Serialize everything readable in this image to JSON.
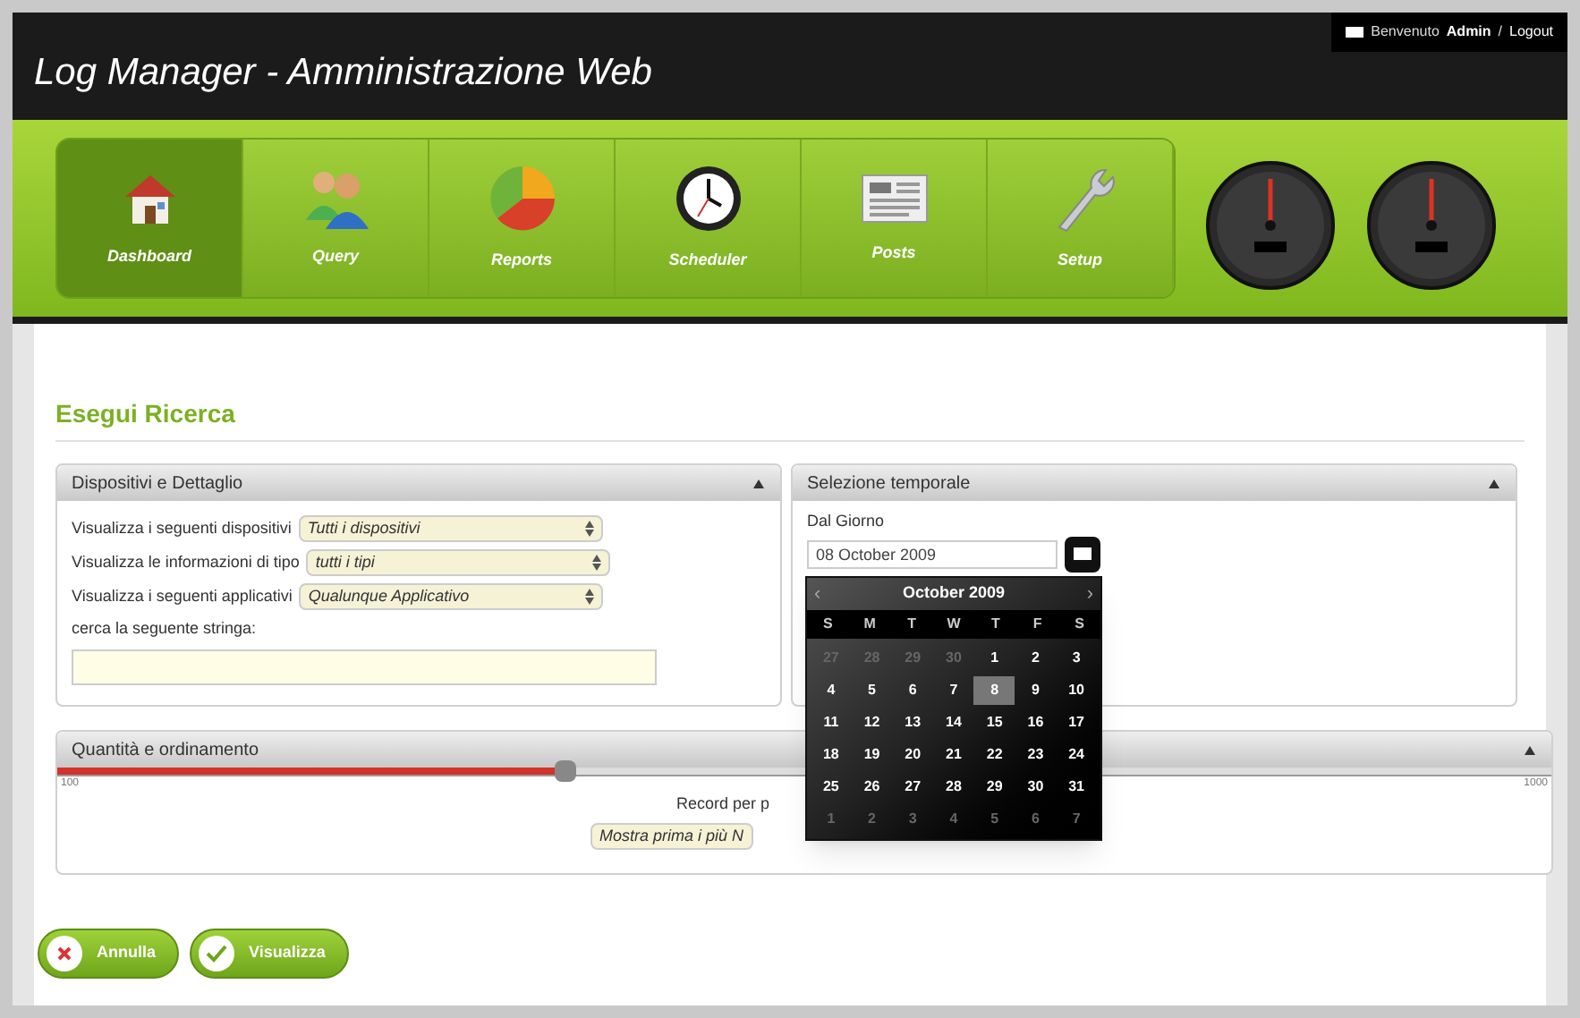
{
  "header": {
    "title": "Log Manager - Amministrazione Web",
    "welcome": "Benvenuto",
    "user": "Admin",
    "separator": "/",
    "logout": "Logout"
  },
  "nav": [
    {
      "label": "Dashboard",
      "selected": true
    },
    {
      "label": "Query",
      "selected": false
    },
    {
      "label": "Reports",
      "selected": false
    },
    {
      "label": "Scheduler",
      "selected": false
    },
    {
      "label": "Posts",
      "selected": false
    },
    {
      "label": "Setup",
      "selected": false
    }
  ],
  "page_title": "Esegui Ricerca",
  "devices_panel": {
    "title": "Dispositivi e Dettaglio",
    "expanded": true,
    "fields": [
      {
        "label": "Visualizza i seguenti dispositivi",
        "value": "Tutti i dispositivi"
      },
      {
        "label": "Visualizza le informazioni di tipo",
        "value": "tutti i tipi"
      },
      {
        "label": "Visualizza i seguenti applicativi",
        "value": "Qualunque Applicativo"
      }
    ],
    "search_label": "cerca la seguente stringa:"
  },
  "time_panel": {
    "title": "Selezione temporale",
    "expanded": true,
    "date_label": "Dal Giorno",
    "date_value": "08 October 2009"
  },
  "quantity_panel": {
    "title": "Quantità e ordinamento",
    "expanded": true,
    "slider": {
      "level": 0.34,
      "min_label": "100",
      "max_label": "1000"
    },
    "records_label": "Record per p",
    "order_value": "Mostra prima i più N"
  },
  "calendar": {
    "month": "October 2009",
    "prev": "‹",
    "next": "›",
    "weekdays": [
      "S",
      "M",
      "T",
      "W",
      "T",
      "F",
      "S"
    ],
    "days": [
      {
        "text": "27",
        "muted": true,
        "selected": false
      },
      {
        "text": "28",
        "muted": true,
        "selected": false
      },
      {
        "text": "29",
        "muted": true,
        "selected": false
      },
      {
        "text": "30",
        "muted": true,
        "selected": false
      },
      {
        "text": "1",
        "muted": false,
        "selected": false
      },
      {
        "text": "2",
        "muted": false,
        "selected": false
      },
      {
        "text": "3",
        "muted": false,
        "selected": false
      },
      {
        "text": "4",
        "muted": false,
        "selected": false
      },
      {
        "text": "5",
        "muted": false,
        "selected": false
      },
      {
        "text": "6",
        "muted": false,
        "selected": false
      },
      {
        "text": "7",
        "muted": false,
        "selected": false
      },
      {
        "text": "8",
        "muted": false,
        "selected": true
      },
      {
        "text": "9",
        "muted": false,
        "selected": false
      },
      {
        "text": "10",
        "muted": false,
        "selected": false
      },
      {
        "text": "11",
        "muted": false,
        "selected": false
      },
      {
        "text": "12",
        "muted": false,
        "selected": false
      },
      {
        "text": "13",
        "muted": false,
        "selected": false
      },
      {
        "text": "14",
        "muted": false,
        "selected": false
      },
      {
        "text": "15",
        "muted": false,
        "selected": false
      },
      {
        "text": "16",
        "muted": false,
        "selected": false
      },
      {
        "text": "17",
        "muted": false,
        "selected": false
      },
      {
        "text": "18",
        "muted": false,
        "selected": false
      },
      {
        "text": "19",
        "muted": false,
        "selected": false
      },
      {
        "text": "20",
        "muted": false,
        "selected": false
      },
      {
        "text": "21",
        "muted": false,
        "selected": false
      },
      {
        "text": "22",
        "muted": false,
        "selected": false
      },
      {
        "text": "23",
        "muted": false,
        "selected": false
      },
      {
        "text": "24",
        "muted": false,
        "selected": false
      },
      {
        "text": "25",
        "muted": false,
        "selected": false
      },
      {
        "text": "26",
        "muted": false,
        "selected": false
      },
      {
        "text": "27",
        "muted": false,
        "selected": false
      },
      {
        "text": "28",
        "muted": false,
        "selected": false
      },
      {
        "text": "29",
        "muted": false,
        "selected": false
      },
      {
        "text": "30",
        "muted": false,
        "selected": false
      },
      {
        "text": "31",
        "muted": false,
        "selected": false
      },
      {
        "text": "1",
        "muted": true,
        "selected": false
      },
      {
        "text": "2",
        "muted": true,
        "selected": false
      },
      {
        "text": "3",
        "muted": true,
        "selected": false
      },
      {
        "text": "4",
        "muted": true,
        "selected": false
      },
      {
        "text": "5",
        "muted": true,
        "selected": false
      },
      {
        "text": "6",
        "muted": true,
        "selected": false
      },
      {
        "text": "7",
        "muted": true,
        "selected": false
      }
    ]
  },
  "buttons": [
    {
      "label": "Annulla",
      "kind": "cancel"
    },
    {
      "label": "Visualizza",
      "kind": "ok"
    }
  ]
}
